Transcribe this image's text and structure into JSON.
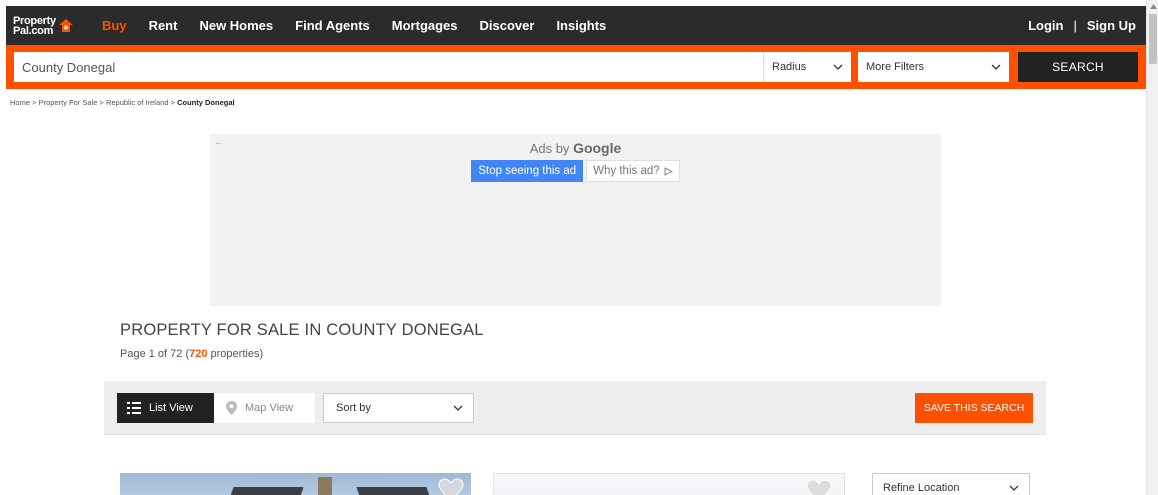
{
  "nav": {
    "logo_line1": "Property",
    "logo_line2": "Pal.com",
    "items": [
      {
        "label": "Buy",
        "active": true
      },
      {
        "label": "Rent"
      },
      {
        "label": "New Homes"
      },
      {
        "label": "Find Agents"
      },
      {
        "label": "Mortgages"
      },
      {
        "label": "Discover"
      },
      {
        "label": "Insights"
      }
    ],
    "login": "Login",
    "separator": "|",
    "signup": "Sign Up"
  },
  "search": {
    "location_value": "County Donegal",
    "radius_label": "Radius",
    "filters_label": "More Filters",
    "search_button": "SEARCH"
  },
  "breadcrumb": {
    "items": [
      "Home",
      "Property For Sale",
      "Republic of Ireland"
    ],
    "separator": ">",
    "current": "County Donegal"
  },
  "ad": {
    "back_arrow": "←",
    "ads_by": "Ads by",
    "brand": "Google",
    "stop_button": "Stop seeing this ad",
    "why_button": "Why this ad?"
  },
  "results": {
    "title": "PROPERTY FOR SALE IN COUNTY DONEGAL",
    "page_prefix": "Page 1 of 72 (",
    "count": "720",
    "count_suffix": " properties)"
  },
  "toolbar": {
    "list_view": "List View",
    "map_view": "Map View",
    "sort_label": "Sort by",
    "save_search": "SAVE THIS SEARCH"
  },
  "sidebar": {
    "refine_location": "Refine Location"
  },
  "colors": {
    "brand_orange": "#ff5000",
    "nav_dark": "#2b2b2b",
    "ad_blue": "#4285f4"
  }
}
